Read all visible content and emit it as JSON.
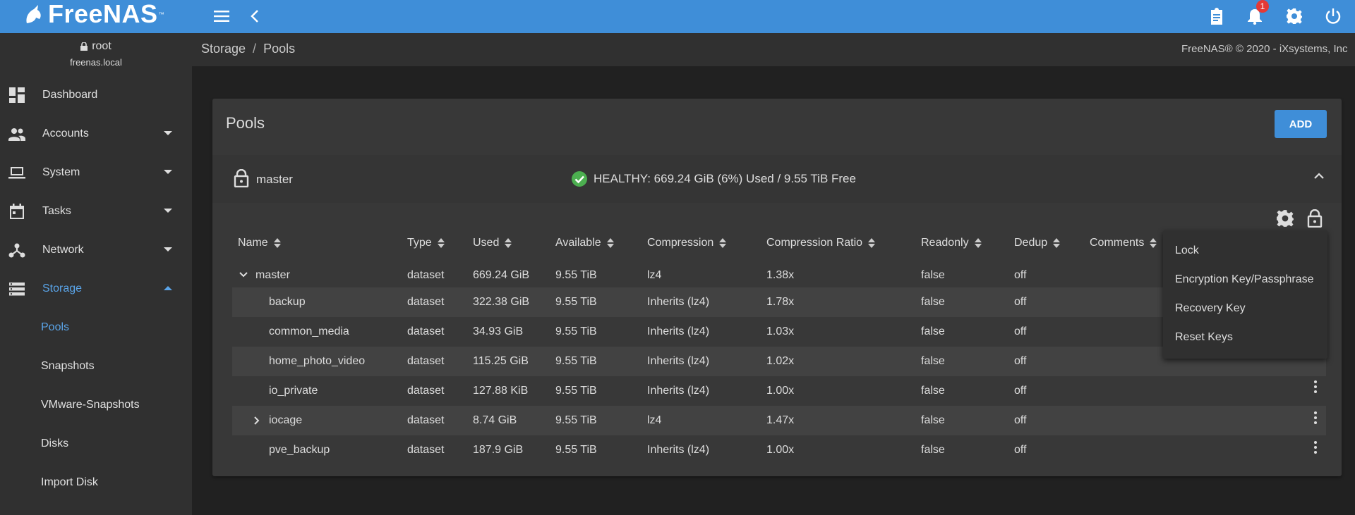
{
  "topbar": {
    "brand": "FreeNAS",
    "trademark": "™",
    "notification_count": "1",
    "color": "#3f8ed8"
  },
  "user": {
    "name": "root",
    "host": "freenas.local"
  },
  "sidebar": {
    "items": [
      {
        "label": "Dashboard",
        "icon": "dashboard-icon"
      },
      {
        "label": "Accounts",
        "icon": "people-icon"
      },
      {
        "label": "System",
        "icon": "laptop-icon"
      },
      {
        "label": "Tasks",
        "icon": "calendar-icon"
      },
      {
        "label": "Network",
        "icon": "network-icon"
      },
      {
        "label": "Storage",
        "icon": "storage-icon"
      }
    ],
    "storage_subitems": [
      "Pools",
      "Snapshots",
      "VMware-Snapshots",
      "Disks",
      "Import Disk"
    ],
    "accent": "#5aa4e8"
  },
  "breadcrumb": {
    "root": "Storage",
    "separator": "/",
    "current": "Pools"
  },
  "copyright": "FreeNAS® © 2020 - iXsystems, Inc",
  "card": {
    "title": "Pools",
    "add_label": "ADD"
  },
  "pool": {
    "name": "master",
    "status": "HEALTHY: 669.24 GiB (6%) Used / 9.55 TiB Free",
    "status_color": "#4caf50"
  },
  "table": {
    "headers": [
      "Name",
      "Type",
      "Used",
      "Available",
      "Compression",
      "Compression Ratio",
      "Readonly",
      "Dedup",
      "Comments"
    ],
    "rows": [
      {
        "name": "master",
        "type": "dataset",
        "used": "669.24 GiB",
        "available": "9.55 TiB",
        "compression": "lz4",
        "ratio": "1.38x",
        "readonly": "false",
        "dedup": "off"
      },
      {
        "name": "backup",
        "type": "dataset",
        "used": "322.38 GiB",
        "available": "9.55 TiB",
        "compression": "Inherits (lz4)",
        "ratio": "1.78x",
        "readonly": "false",
        "dedup": "off"
      },
      {
        "name": "common_media",
        "type": "dataset",
        "used": "34.93 GiB",
        "available": "9.55 TiB",
        "compression": "Inherits (lz4)",
        "ratio": "1.03x",
        "readonly": "false",
        "dedup": "off"
      },
      {
        "name": "home_photo_video",
        "type": "dataset",
        "used": "115.25 GiB",
        "available": "9.55 TiB",
        "compression": "Inherits (lz4)",
        "ratio": "1.02x",
        "readonly": "false",
        "dedup": "off"
      },
      {
        "name": "io_private",
        "type": "dataset",
        "used": "127.88 KiB",
        "available": "9.55 TiB",
        "compression": "Inherits (lz4)",
        "ratio": "1.00x",
        "readonly": "false",
        "dedup": "off"
      },
      {
        "name": "iocage",
        "type": "dataset",
        "used": "8.74 GiB",
        "available": "9.55 TiB",
        "compression": "lz4",
        "ratio": "1.47x",
        "readonly": "false",
        "dedup": "off"
      },
      {
        "name": "pve_backup",
        "type": "dataset",
        "used": "187.9 GiB",
        "available": "9.55 TiB",
        "compression": "Inherits (lz4)",
        "ratio": "1.00x",
        "readonly": "false",
        "dedup": "off"
      }
    ]
  },
  "lock_menu": {
    "items": [
      "Lock",
      "Encryption Key/Passphrase",
      "Recovery Key",
      "Reset Keys"
    ]
  }
}
